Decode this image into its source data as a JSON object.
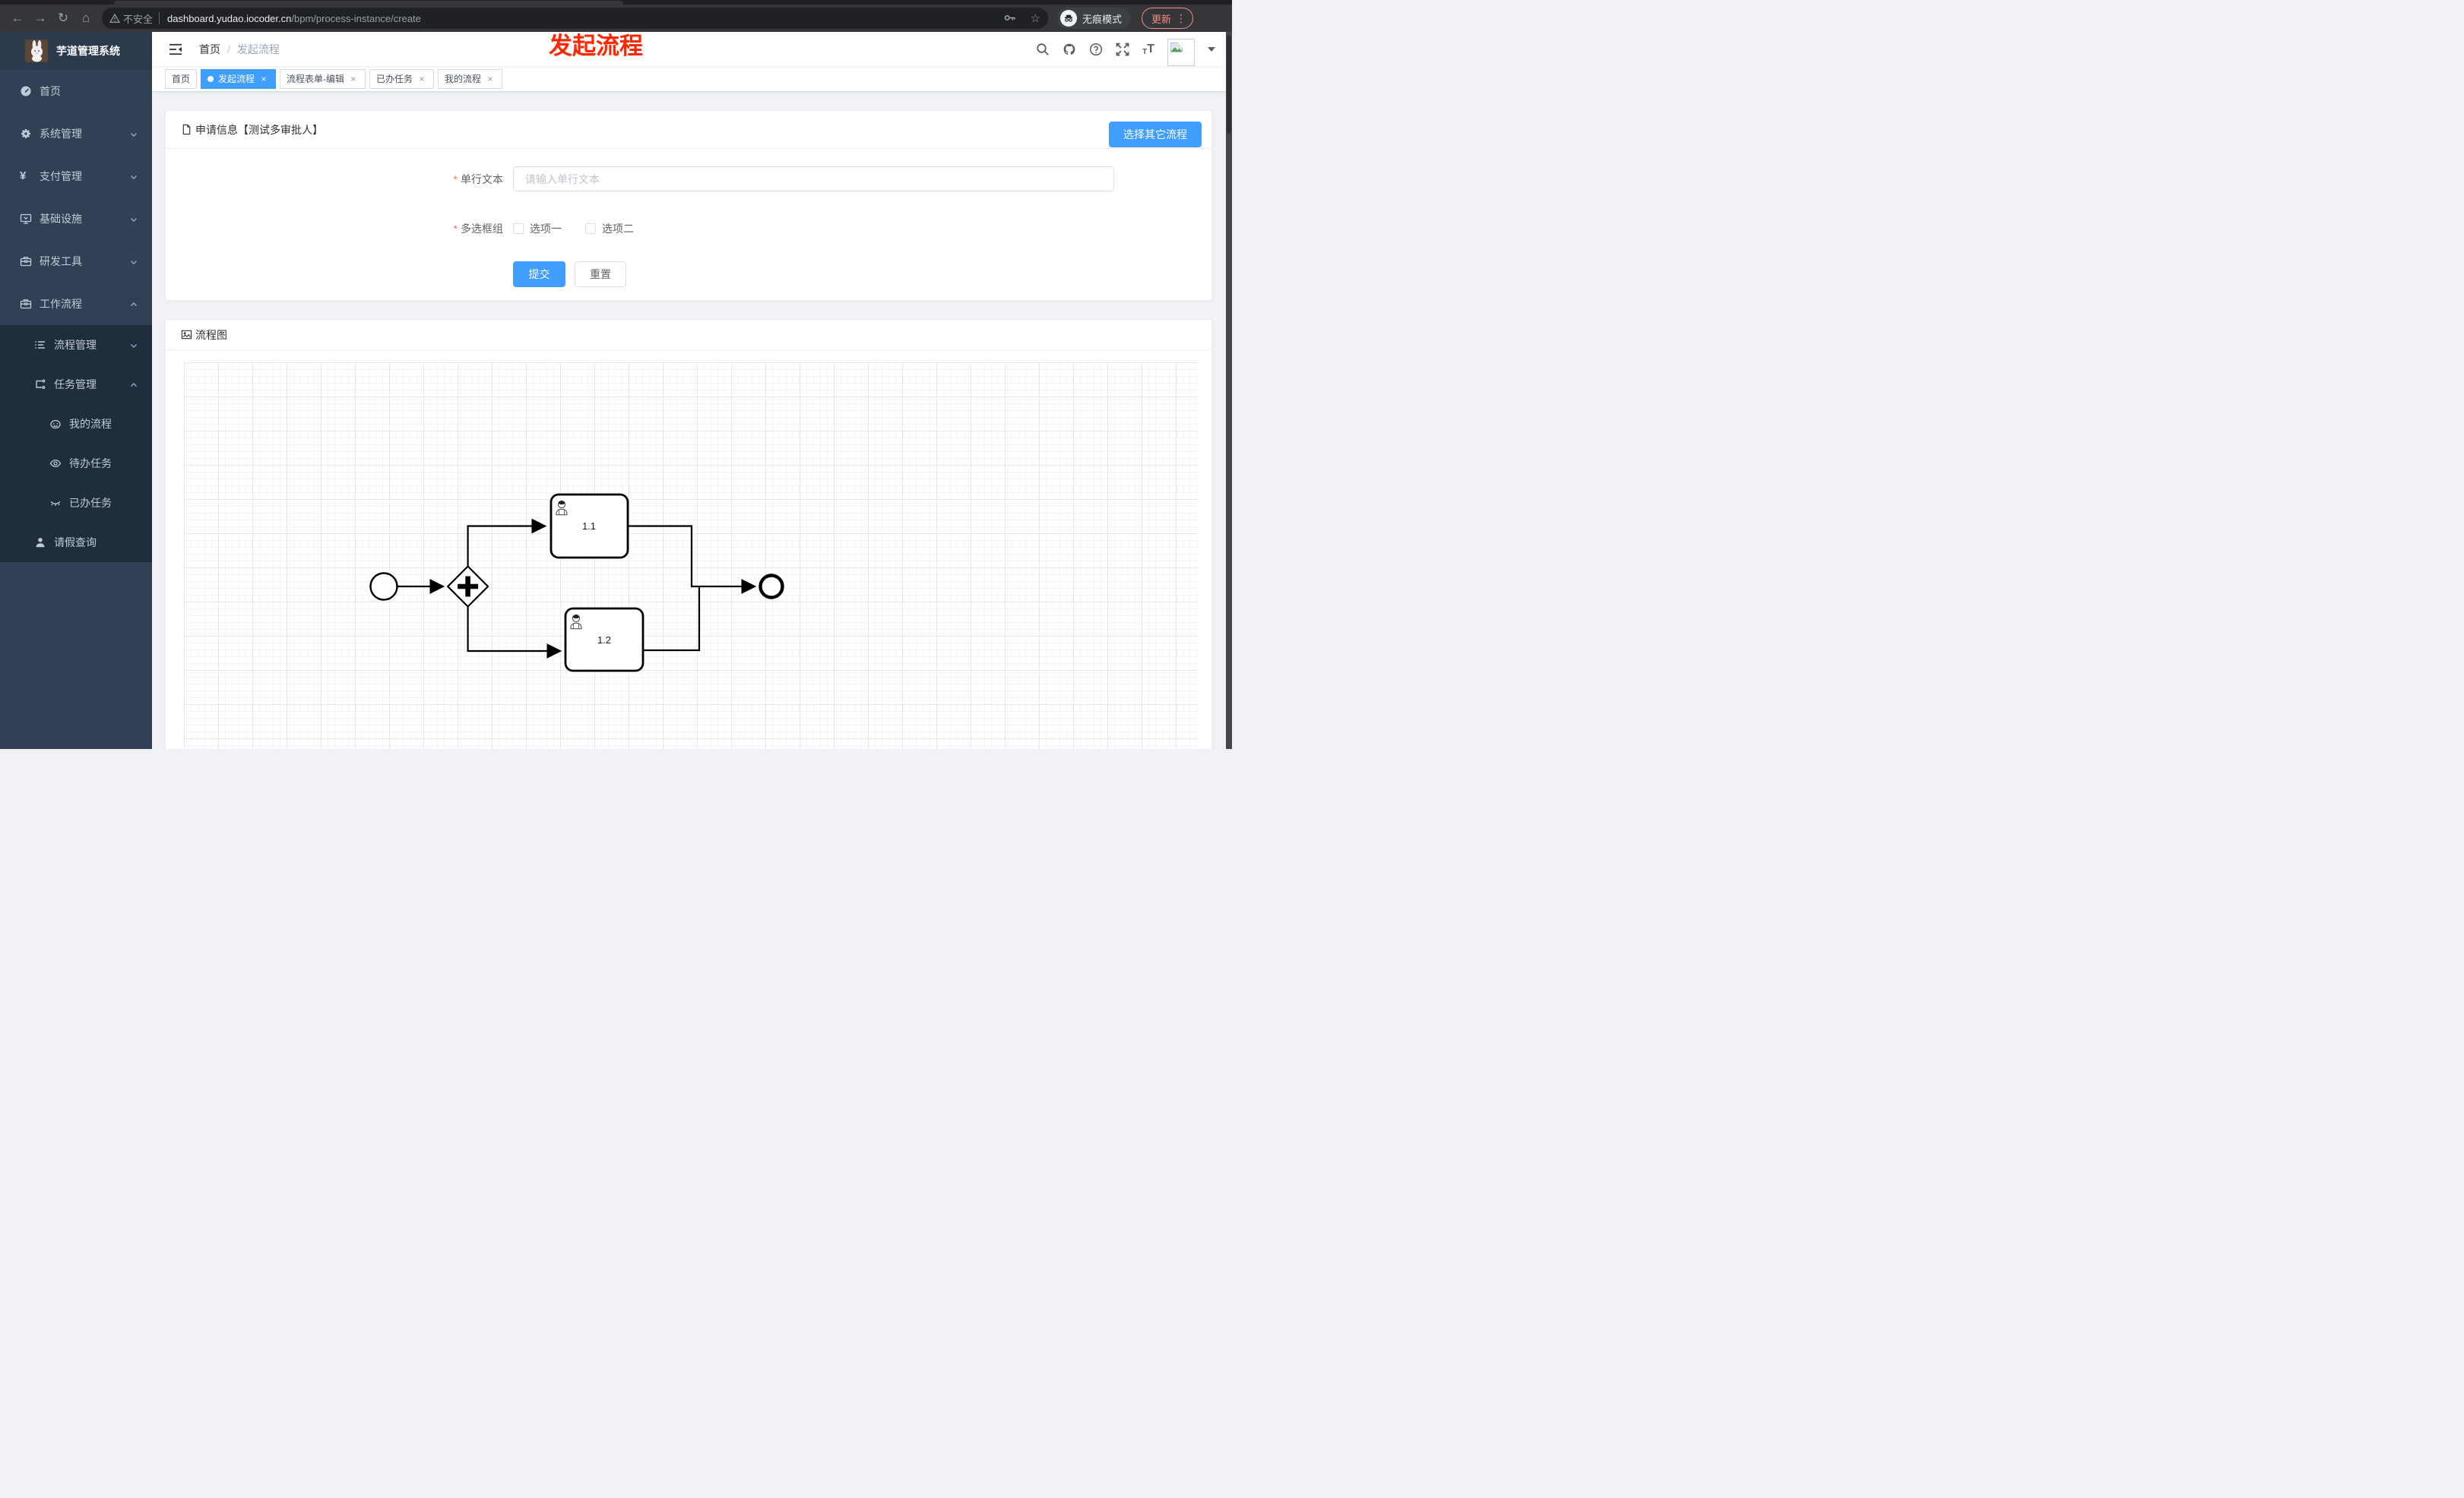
{
  "browser": {
    "back_glyph": "←",
    "forward_glyph": "→",
    "reload_glyph": "↻",
    "home_glyph": "⌂",
    "security_chip": "不安全",
    "url_host": "dashboard.yudao.iocoder.cn",
    "url_path": "/bpm/process-instance/create",
    "star_glyph": "☆",
    "incognito_label": "无痕模式",
    "update_button": "更新",
    "menu_dots": "⋮"
  },
  "annotation": {
    "text": "发起流程",
    "color": "#ff2600"
  },
  "sidebar": {
    "title": "芋道管理系统",
    "items": [
      {
        "label": "首页"
      },
      {
        "label": "系统管理"
      },
      {
        "label": "支付管理"
      },
      {
        "label": "基础设施"
      },
      {
        "label": "研发工具"
      },
      {
        "label": "工作流程"
      }
    ],
    "submenu": {
      "process_mgmt": "流程管理",
      "task_mgmt": "任务管理",
      "my_process": "我的流程",
      "todo_tasks": "待办任务",
      "done_tasks": "已办任务",
      "leave_query": "请假查询"
    }
  },
  "breadcrumb": {
    "root": "首页",
    "separator": "/",
    "current": "发起流程"
  },
  "header_icons": {
    "help_glyph": "?",
    "font_size_small": "T",
    "font_size_big": "T"
  },
  "tabs": [
    {
      "label": "首页",
      "active": false,
      "closable": false
    },
    {
      "label": "发起流程",
      "active": true,
      "closable": true
    },
    {
      "label": "流程表单-编辑",
      "active": false,
      "closable": true
    },
    {
      "label": "已办任务",
      "active": false,
      "closable": true
    },
    {
      "label": "我的流程",
      "active": false,
      "closable": true
    }
  ],
  "tab_close_glyph": "×",
  "form_card": {
    "title": "申请信息【测试多审批人】",
    "select_other_button": "选择其它流程",
    "required_mark": "*",
    "single_text_label": "单行文本",
    "single_text_placeholder": "请输入单行文本",
    "checkbox_group_label": "多选框组",
    "option1": "选项一",
    "option2": "选项二",
    "submit_button": "提交",
    "reset_button": "重置"
  },
  "diagram_card": {
    "title": "流程图",
    "type": "bpmn",
    "nodes": {
      "start_event": "start",
      "parallel_gateway": "parallel-gateway",
      "task1_label": "1.1",
      "task2_label": "1.2",
      "end_event": "end"
    }
  },
  "colors": {
    "primary": "#409eff",
    "sidebar_bg": "#304156",
    "submenu_bg": "#1f2d3d",
    "annotation_red": "#ff2600",
    "required_red": "#f56c6c"
  }
}
